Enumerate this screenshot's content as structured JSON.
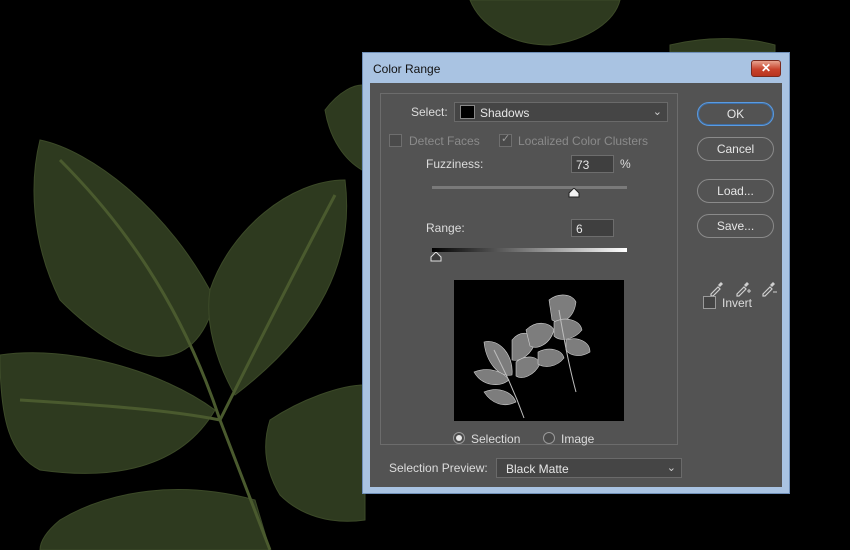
{
  "dialog": {
    "title": "Color Range",
    "close_label": "✕"
  },
  "select": {
    "label": "Select:",
    "value": "Shadows"
  },
  "detect_faces": {
    "label": "Detect Faces",
    "checked": false
  },
  "localized_clusters": {
    "label": "Localized Color Clusters",
    "checked": true
  },
  "fuzziness": {
    "label": "Fuzziness:",
    "value": "73",
    "unit": "%"
  },
  "range": {
    "label": "Range:",
    "value": "6"
  },
  "preview_mode": {
    "selection_label": "Selection",
    "image_label": "Image",
    "selected": "Selection"
  },
  "selection_preview": {
    "label": "Selection Preview:",
    "value": "Black Matte"
  },
  "buttons": {
    "ok": "OK",
    "cancel": "Cancel",
    "load": "Load...",
    "save": "Save..."
  },
  "eyedroppers": [
    "eyedropper-icon",
    "eyedropper-plus-icon",
    "eyedropper-minus-icon"
  ],
  "invert": {
    "label": "Invert",
    "checked": false
  },
  "colors": {
    "panel": "#535353",
    "titlebar": "#a9c3e2",
    "accent": "#5b9be0",
    "leaf": "#2f3b1f"
  }
}
